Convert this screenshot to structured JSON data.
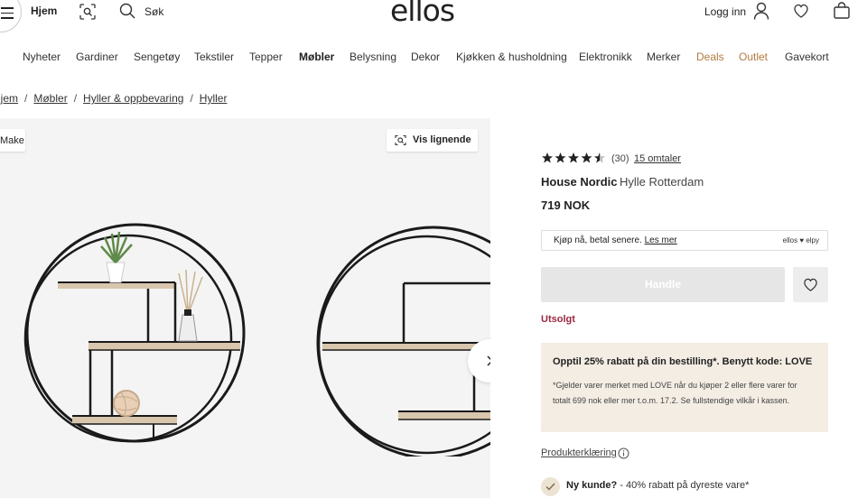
{
  "header": {
    "home_label": "Hjem",
    "search_label": "Søk",
    "logo": "ellos",
    "login_label": "Logg inn"
  },
  "categories": [
    {
      "label": "Nyheter"
    },
    {
      "label": "Gardiner"
    },
    {
      "label": "Sengetøy"
    },
    {
      "label": "Tekstiler"
    },
    {
      "label": "Tepper"
    },
    {
      "label": "Møbler"
    },
    {
      "label": "Belysning"
    },
    {
      "label": "Dekor"
    },
    {
      "label": "Kjøkken & husholdning"
    },
    {
      "label": "Elektronikk"
    },
    {
      "label": "Merker"
    },
    {
      "label": "Deals"
    },
    {
      "label": "Outlet"
    },
    {
      "label": "Gavekort"
    }
  ],
  "breadcrumb": [
    "Hjem",
    "Møbler",
    "Hyller & oppbevaring",
    "Hyller"
  ],
  "gallery": {
    "left_pill": "Make",
    "similar_label": "Vis lignende"
  },
  "product": {
    "rating": 4.5,
    "rating_count": "(30)",
    "reviews_label": "15 omtaler",
    "brand": "House Nordic",
    "name": "Hylle Rotterdam",
    "price": "719 NOK",
    "bnpl_text": "Kjøp nå, betal senere.",
    "bnpl_link": "Les mer",
    "bnpl_logo": "ellos ♥ elpy",
    "buy_label": "Handle",
    "status": "Utsolgt",
    "promo_title": "Opptil 25% rabatt på din bestilling*. Benytt kode: LOVE",
    "promo_body": "*Gjelder varer merket med LOVE når du kjøper 2 eller flere varer for totalt 699 nok eller mer t.o.m. 17.2. Se fullstendige vilkår i kassen.",
    "declaration_label": "Produkterklæring",
    "new_customer_bold": "Ny kunde?",
    "new_customer_text": " - 40% rabatt på dyreste vare*"
  },
  "colors": {
    "accent_deal": "#b37a3f",
    "sold_out": "#9b2740",
    "promo_bg": "#f3ede4"
  }
}
